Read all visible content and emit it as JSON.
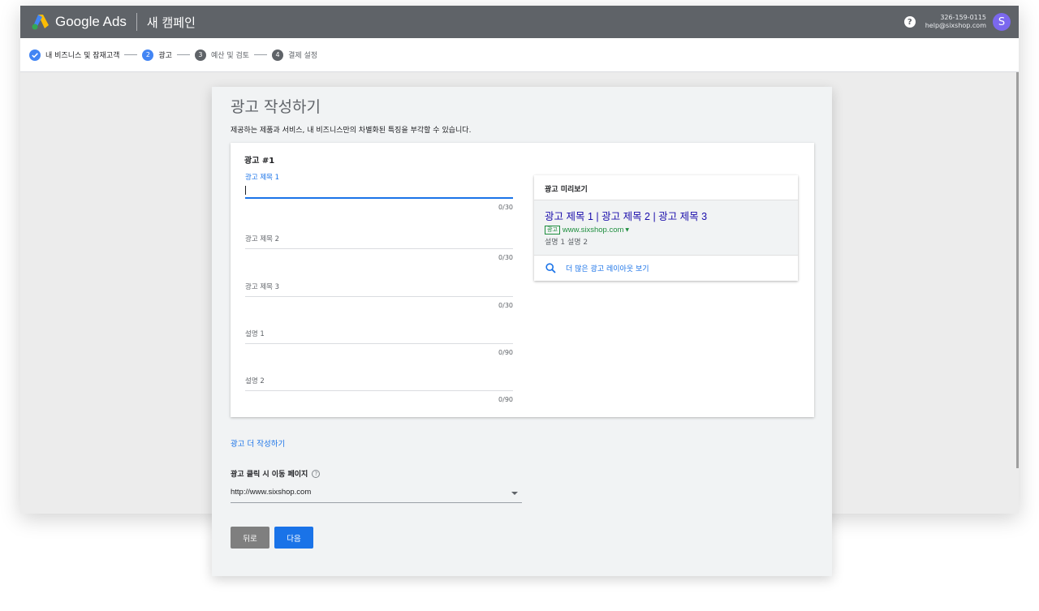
{
  "header": {
    "brand": "Google Ads",
    "campaign": "새 캠페인",
    "help_icon": "help-circle-icon",
    "account_id": "326-159-0115",
    "account_email": "help@sixshop.com",
    "avatar_letter": "S",
    "bar_color": "#5f6368"
  },
  "stepper": {
    "steps": [
      {
        "num": "",
        "label": "내 비즈니스 및 잠재고객",
        "state": "done"
      },
      {
        "num": "2",
        "label": "광고",
        "state": "active"
      },
      {
        "num": "3",
        "label": "예산 및 검토",
        "state": "pending"
      },
      {
        "num": "4",
        "label": "결제 설정",
        "state": "pending"
      }
    ]
  },
  "page": {
    "title": "광고 작성하기",
    "description": "제공하는 제품과 서비스, 내 비즈니스만의 차별화된 특징을 부각할 수 있습니다."
  },
  "ad": {
    "title": "광고 #1",
    "fields": [
      {
        "label": "광고 제목 1",
        "value": "",
        "counter": "0/30",
        "focused": true
      },
      {
        "label": "광고 제목 2",
        "value": "",
        "counter": "0/30",
        "focused": false
      },
      {
        "label": "광고 제목 3",
        "value": "",
        "counter": "0/30",
        "focused": false
      },
      {
        "label": "설명 1",
        "value": "",
        "counter": "0/90",
        "focused": false
      },
      {
        "label": "설명 2",
        "value": "",
        "counter": "0/90",
        "focused": false
      }
    ]
  },
  "preview": {
    "title": "광고 미리보기",
    "headline": "광고 제목 1 | 광고 제목 2 | 광고 제목 3",
    "badge": "광고",
    "url": "www.sixshop.com",
    "description": "설명 1 설명 2",
    "more_link": "더 많은 광고 레이아웃 보기"
  },
  "more_ads": "광고 더 작성하기",
  "final_url": {
    "label": "광고 클릭 시 이동 페이지",
    "help": "?",
    "value": "http://www.sixshop.com"
  },
  "buttons": {
    "back": "뒤로",
    "next": "다음"
  },
  "colors": {
    "accent": "#1a73e8",
    "headline_link": "#1a0dab",
    "url_green": "#1e8e3e"
  }
}
